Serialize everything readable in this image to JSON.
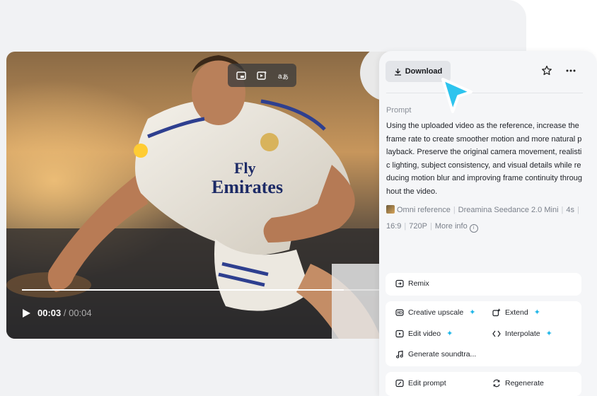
{
  "player": {
    "time_current": "00:03",
    "time_separator": " / ",
    "time_total": "00:04",
    "progress": 0.9
  },
  "panel": {
    "download_label": "Download",
    "prompt_label": "Prompt",
    "prompt_text": "Using the uploaded video as the reference, increase the frame rate to create smoother motion and more natural playback. Preserve the original camera movement, realistic lighting, subject consistency, and visual details while reducing motion blur and improving frame continuity throughout the video.",
    "meta": {
      "reference": "Omni reference",
      "model": "Dreamina Seedance 2.0 Mini",
      "duration": "4s",
      "ratio": "16:9",
      "resolution": "720P",
      "more_info": "More info"
    },
    "actions": {
      "remix": "Remix",
      "creative_upscale": "Creative upscale",
      "extend": "Extend",
      "edit_video": "Edit video",
      "interpolate": "Interpolate",
      "generate_soundtrack": "Generate soundtra...",
      "edit_prompt": "Edit prompt",
      "regenerate": "Regenerate"
    }
  },
  "colors": {
    "accent": "#1fb6e8",
    "panel_bg": "#f5f6f8",
    "backdrop": "#f1f2f4"
  }
}
